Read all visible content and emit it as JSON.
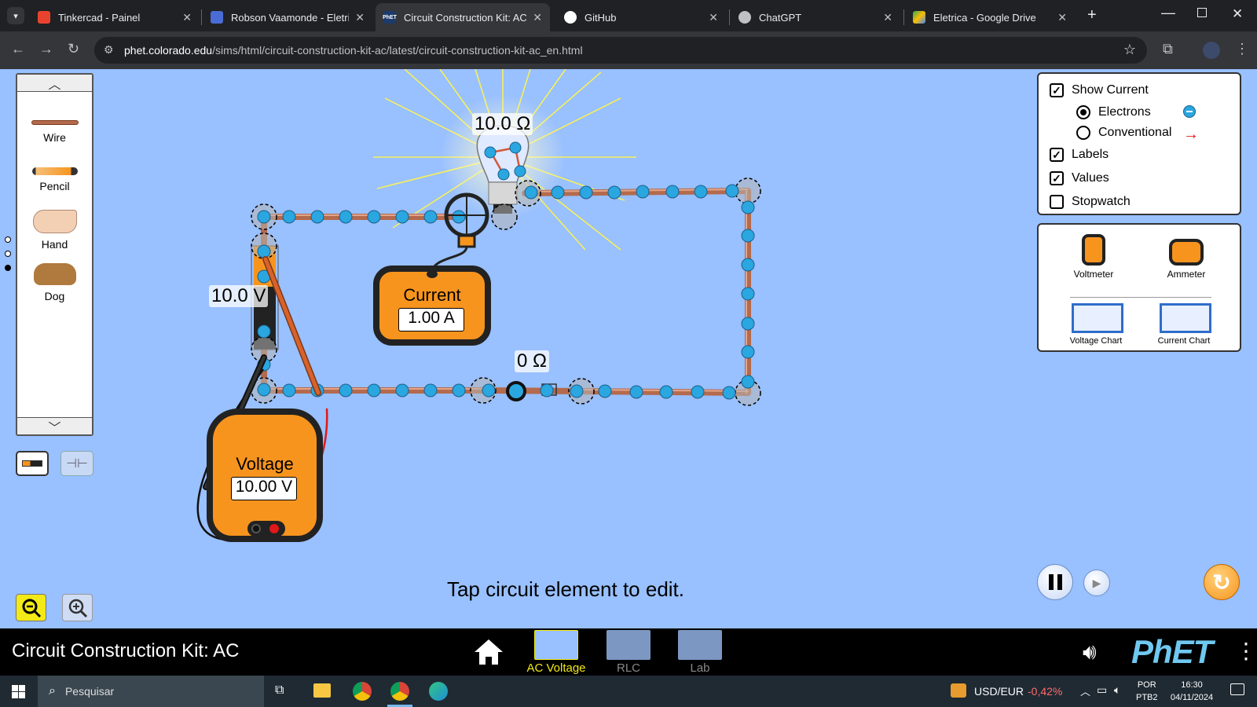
{
  "browser": {
    "tabs": [
      {
        "title": "Tinkercad - Painel",
        "favicon_color": "#e8432e"
      },
      {
        "title": "Robson Vaamonde - Eletricid",
        "favicon_color": "#4a6cd4"
      },
      {
        "title": "Circuit Construction Kit: AC",
        "favicon_color": "#2f6dc9",
        "active": true
      },
      {
        "title": "GitHub",
        "favicon_color": "#ffffff"
      },
      {
        "title": "ChatGPT",
        "favicon_color": "#bdc1c6"
      },
      {
        "title": "Eletrica - Google Drive",
        "favicon_color": "#fbbc04"
      }
    ],
    "url_host": "phet.colorado.edu",
    "url_path": "/sims/html/circuit-construction-kit-ac/latest/circuit-construction-kit-ac_en.html"
  },
  "carousel": {
    "items": [
      {
        "label": "Wire"
      },
      {
        "label": "Pencil"
      },
      {
        "label": "Hand"
      },
      {
        "label": "Dog"
      }
    ]
  },
  "circuit": {
    "bulb_resistance": "10.0 Ω",
    "battery_voltage": "10.0 V",
    "switch_resistance": "0 Ω"
  },
  "ammeter": {
    "title": "Current",
    "reading": "1.00 A"
  },
  "voltmeter": {
    "title": "Voltage",
    "reading": "10.00 V"
  },
  "controls": {
    "show_current": {
      "label": "Show Current",
      "checked": true
    },
    "electrons": {
      "label": "Electrons",
      "selected": true
    },
    "conventional": {
      "label": "Conventional",
      "selected": false
    },
    "labels": {
      "label": "Labels",
      "checked": true
    },
    "values": {
      "label": "Values",
      "checked": true
    },
    "stopwatch": {
      "label": "Stopwatch",
      "checked": false
    }
  },
  "toolbox": {
    "voltmeter": "Voltmeter",
    "ammeter": "Ammeter",
    "voltage_chart": "Voltage Chart",
    "current_chart": "Current Chart"
  },
  "status_message": "Tap circuit element to edit.",
  "navbar": {
    "sim_title": "Circuit Construction Kit: AC",
    "screens": [
      {
        "label": "AC Voltage",
        "active": true
      },
      {
        "label": "RLC",
        "active": false
      },
      {
        "label": "Lab",
        "active": false
      }
    ],
    "brand": "PhET"
  },
  "taskbar": {
    "search_placeholder": "Pesquisar",
    "ticker_name": "USD/EUR",
    "ticker_change": "-0,42%",
    "lang_top": "POR",
    "lang_bottom": "PTB2",
    "time": "16:30",
    "date": "04/11/2024"
  },
  "colors": {
    "sim_background": "#99c0ff",
    "meter_orange": "#f7941e",
    "electron_blue": "#2aa6e0",
    "wire_copper": "#c8785a",
    "navbar_active": "#f2e916",
    "ticker_negative": "#ff6b6b"
  }
}
